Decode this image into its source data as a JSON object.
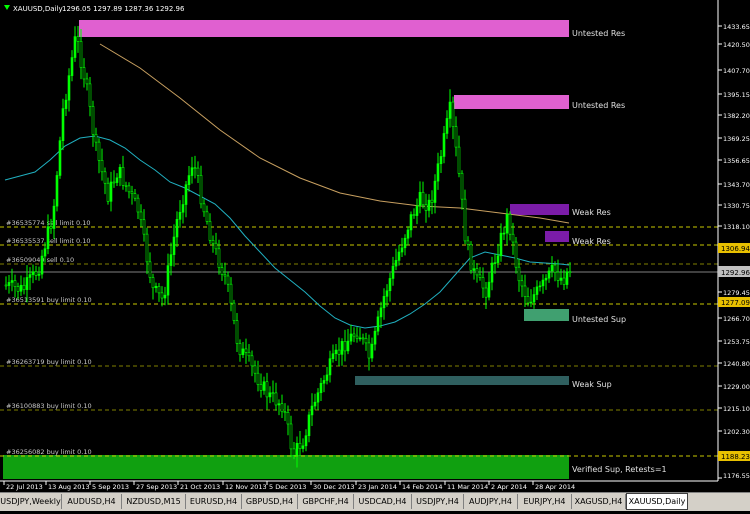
{
  "window": {
    "symbol_title": "XAUUSD,Daily",
    "ohlc": "1296.05 1297.89 1287.36 1292.96"
  },
  "colors": {
    "background": "#000000",
    "candle": "#00ff00",
    "price_axis": "#ffffff",
    "ma_slow": "#c8a060",
    "ma_fast": "#20b0c0",
    "untested_res": "#e060d0",
    "weak_res": "#7b1ca8",
    "untested_sup": "#40a070",
    "weak_sup": "#2f5f5f",
    "verified_sup": "#10a010",
    "order_line": "#c8c800",
    "current_price_label": "#c0c0c0",
    "order_price_label": "#e8c000"
  },
  "price_axis_labels": [
    "1433.65",
    "1420.50",
    "1407.70",
    "1395.15",
    "1382.20",
    "1369.25",
    "1356.65",
    "1343.70",
    "1330.75",
    "1318.10",
    "1305.15",
    "1292.96",
    "1279.45",
    "1266.70",
    "1253.75",
    "1240.80",
    "1229.00",
    "1215.10",
    "1202.30",
    "1189.50",
    "1176.55"
  ],
  "current_price": "1292.96",
  "order_price_labels": [
    "1306.94",
    "1277.09",
    "1188.23"
  ],
  "time_axis_labels": [
    "22 Jul 2013",
    "13 Aug 2013",
    "5 Sep 2013",
    "27 Sep 2013",
    "21 Oct 2013",
    "12 Nov 2013",
    "5 Dec 2013",
    "30 Dec 2013",
    "23 Jan 2014",
    "14 Feb 2014",
    "11 Mar 2014",
    "2 Apr 2014",
    "28 Apr 2014"
  ],
  "zones": [
    {
      "label": "Untested Res",
      "type": "untested_res"
    },
    {
      "label": "Untested Res",
      "type": "untested_res"
    },
    {
      "label": "Weak Res",
      "type": "weak_res"
    },
    {
      "label": "Weak Res",
      "type": "weak_res"
    },
    {
      "label": "Untested Sup",
      "type": "untested_sup"
    },
    {
      "label": "Weak Sup",
      "type": "weak_sup"
    },
    {
      "label": "Verified Sup, Retests=1",
      "type": "verified_sup"
    }
  ],
  "orders": [
    {
      "label": "#36535774 sell limit 0.10"
    },
    {
      "label": "#36535537 sell limit 0.10"
    },
    {
      "label": "#36509040 sell 0.10"
    },
    {
      "label": "#36513591 buy limit 0.10"
    },
    {
      "label": "#36263719 buy limit 0.10"
    },
    {
      "label": "#36100883 buy limit 0.10"
    },
    {
      "label": "#36256082 buy limit 0.10"
    }
  ],
  "tabs": [
    {
      "label": "USDJPY,Weekly",
      "active": false
    },
    {
      "label": "AUDUSD,H4",
      "active": false
    },
    {
      "label": "NZDUSD,M15",
      "active": false
    },
    {
      "label": "EURUSD,H4",
      "active": false
    },
    {
      "label": "GBPUSD,H4",
      "active": false
    },
    {
      "label": "GBPCHF,H4",
      "active": false
    },
    {
      "label": "USDCAD,H4",
      "active": false
    },
    {
      "label": "USDJPY,H4",
      "active": false
    },
    {
      "label": "AUDJPY,H4",
      "active": false
    },
    {
      "label": "EURJPY,H4",
      "active": false
    },
    {
      "label": "XAGUSD,H4",
      "active": false
    },
    {
      "label": "XAUUSD,Daily",
      "active": true
    }
  ]
}
